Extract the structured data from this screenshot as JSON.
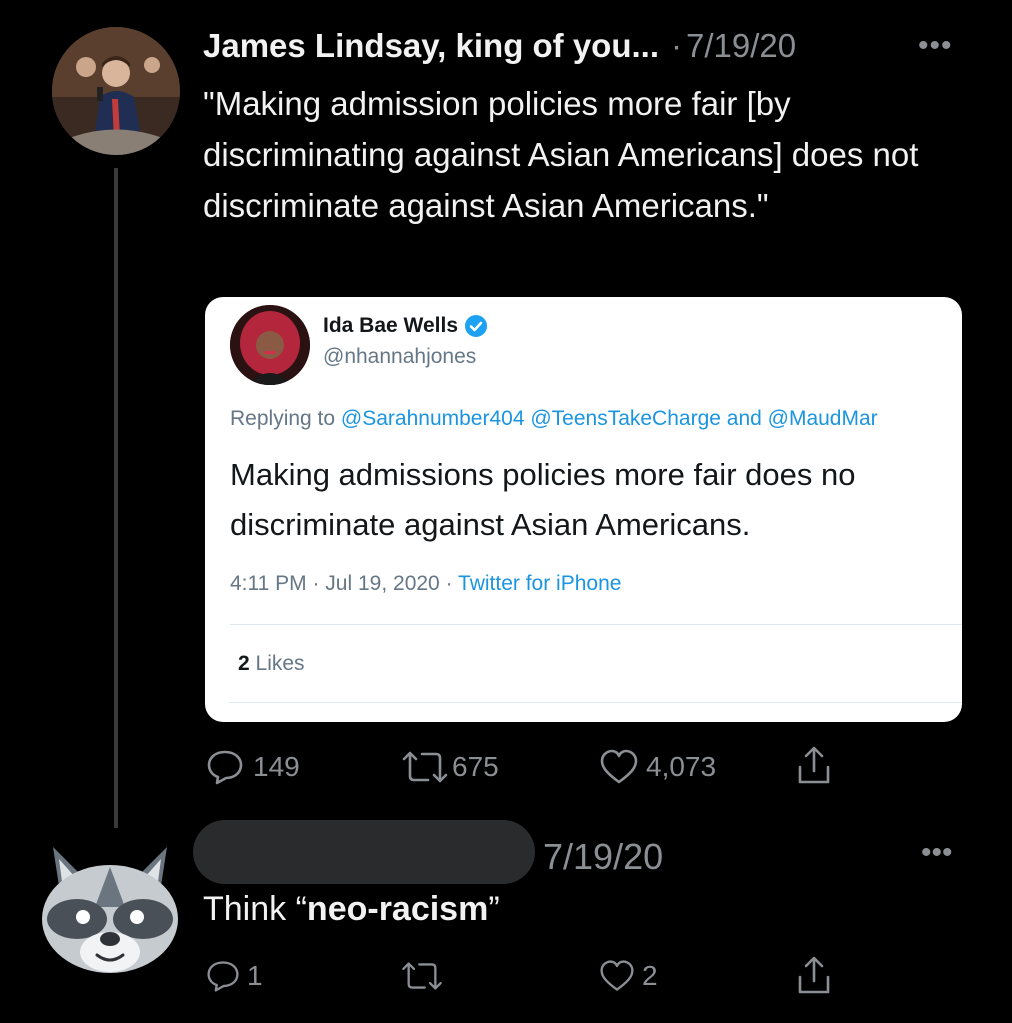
{
  "tweet1": {
    "display_name": "James Lindsay, king of you...",
    "date": "7/19/20",
    "dot": "·",
    "more": "•••",
    "text": "\"Making admission policies more fair [by discriminating against Asian Americans] does not discriminate against Asian Americans.\"",
    "actions": {
      "replies": "149",
      "retweets": "675",
      "likes": "4,073"
    }
  },
  "quoted": {
    "name": "Ida Bae Wells",
    "handle": "@nhannahjones",
    "replying_prefix": "Replying to ",
    "replying_to": "@Sarahnumber404 @TeensTakeCharge and @MaudMar",
    "text_line1": "Making admissions policies more fair does no",
    "text_line2": "discriminate against Asian Americans.",
    "time": "4:11 PM · Jul 19, 2020 · ",
    "source": "Twitter for iPhone",
    "likes_count": "2",
    "likes_label": " Likes"
  },
  "tweet2": {
    "date": "7/19/20",
    "more": "•••",
    "text_prefix": "Think “",
    "text_bold": "neo-racism",
    "text_suffix": "”",
    "actions": {
      "replies": "1",
      "retweets": "",
      "likes": "2"
    }
  },
  "colors": {
    "background": "#000000",
    "muted": "#8b8f94",
    "link": "#1b95e0",
    "verified": "#1da1f2"
  }
}
